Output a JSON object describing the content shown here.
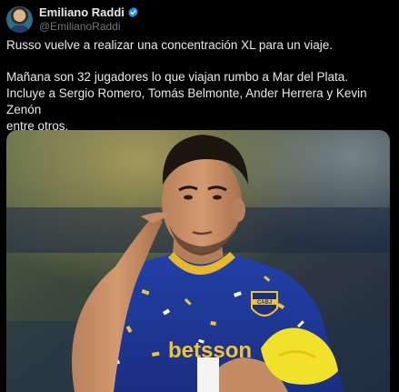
{
  "author": {
    "display_name": "Emiliano Raddi",
    "handle": "@EmilianoRaddi",
    "verified": true,
    "verified_icon": "verified-badge-icon",
    "accent_color": "#1d9bf0"
  },
  "tweet": {
    "line1": "Russo vuelve a realizar una concentración XL para un viaje.",
    "line2": "Mañana son 32 jugadores lo que viajan rumbo a Mar del Plata.",
    "line3": "Incluye a Sergio Romero, Tomás Belmonte, Ander Herrera y Kevin Zenón",
    "line4": "entre otros."
  },
  "media": {
    "shirt_sponsor": "betsson",
    "crest_text": "CABJ"
  }
}
